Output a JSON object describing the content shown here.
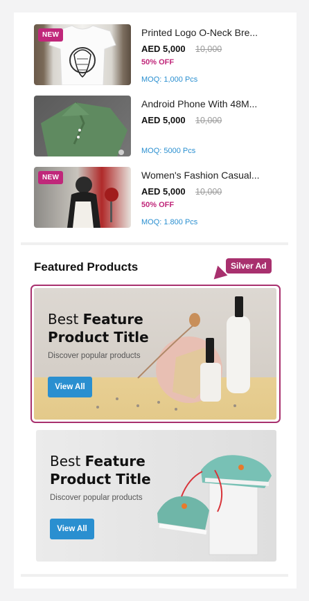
{
  "products": [
    {
      "title": "Printed Logo O-Neck Bre...",
      "price": "AED 5,000",
      "old_price": "10,000",
      "discount": "50% OFF",
      "moq": "MOQ: 1,000 Pcs",
      "badge": "NEW"
    },
    {
      "title": "Android Phone With 48M...",
      "price": "AED 5,000",
      "old_price": "10,000",
      "discount": "",
      "moq": "MOQ: 5000 Pcs",
      "badge": ""
    },
    {
      "title": "Women's Fashion Casual...",
      "price": "AED 5,000",
      "old_price": "10,000",
      "discount": "50% OFF",
      "moq": "MOQ: 1.800 Pcs",
      "badge": "NEW"
    }
  ],
  "featured": {
    "section_title": "Featured Products",
    "ad_label": "Silver Ad",
    "banners": [
      {
        "title_light": "Best ",
        "title_bold_1": "Feature",
        "title_bold_2": "Product Title",
        "subtitle": "Discover popular products",
        "button": "View All"
      },
      {
        "title_light": "Best ",
        "title_bold_1": "Feature",
        "title_bold_2": "Product Title",
        "subtitle": "Discover popular products",
        "button": "View All"
      }
    ]
  },
  "colors": {
    "accent": "#c0277a",
    "ad_accent": "#a8306e",
    "link": "#2a8fd0",
    "button": "#2a8fd0"
  }
}
